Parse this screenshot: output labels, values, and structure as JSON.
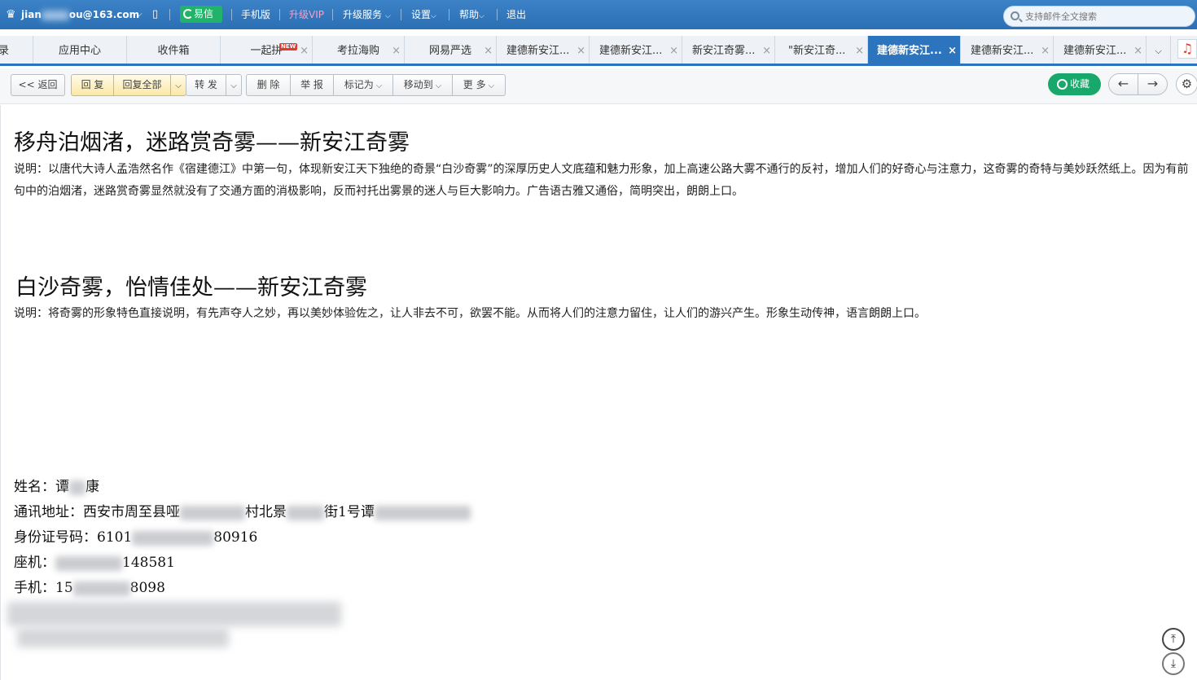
{
  "topbar": {
    "account": "jian",
    "account_tail": "ou@163.com",
    "yixin": "易信",
    "mobile": "手机版",
    "vip": "升级VIP",
    "upgrade": "升级服务",
    "settings": "设置",
    "help": "帮助",
    "logout": "退出",
    "search_placeholder": "支持邮件全文搜索"
  },
  "tabs": [
    {
      "label": "录"
    },
    {
      "label": "应用中心"
    },
    {
      "label": "收件箱"
    },
    {
      "label": "一起拼",
      "badge": "NEW"
    },
    {
      "label": "考拉海购"
    },
    {
      "label": "网易严选"
    },
    {
      "label": "建德新安江..."
    },
    {
      "label": "建德新安江..."
    },
    {
      "label": "新安江奇雾..."
    },
    {
      "label": "\"新安江奇..."
    },
    {
      "label": "建德新安江..."
    },
    {
      "label": "建德新安江..."
    },
    {
      "label": "建德新安江..."
    }
  ],
  "toolbar": {
    "back": "<< 返回",
    "reply": "回 复",
    "reply_all": "回复全部",
    "forward": "转 发",
    "delete": "删 除",
    "report": "举 报",
    "mark_as": "标记为",
    "move_to": "移动到",
    "more": "更 多",
    "favorite": "收藏"
  },
  "content": {
    "heading1": "移舟泊烟渚，迷路赏奇雾——新安江奇雾",
    "desc1": "说明：以唐代大诗人孟浩然名作《宿建德江》中第一句，体现新安江天下独绝的奇景“白沙奇雾”的深厚历史人文底蕴和魅力形象，加上高速公路大雾不通行的反衬，增加人们的好奇心与注意力，这奇雾的奇特与美妙跃然纸上。因为有前句中的泊烟渚，迷路赏奇雾显然就没有了交通方面的消极影响，反而衬托出雾景的迷人与巨大影响力。广告语古雅又通俗，简明突出，朗朗上口。",
    "heading2": "白沙奇雾，怡情佳处——新安江奇雾",
    "desc2": "说明：将奇雾的形象特色直接说明，有先声夺人之妙，再以美妙体验佐之，让人非去不可，欲罢不能。从而将人们的注意力留住，让人们的游兴产生。形象生动传神，语言朗朗上口。",
    "name_label": "姓名：",
    "name_a": "谭",
    "name_b": "康",
    "addr_label": "通讯地址：",
    "addr_a": "西安市周至县哑",
    "addr_b": "村北景",
    "addr_c": "街1号谭",
    "id_label": "身份证号码：",
    "id_a": "6101",
    "id_b": "80916",
    "phone_label": "座机：",
    "phone_b": "148581",
    "mobile_label": "手机：",
    "mobile_a": "15",
    "mobile_b": "8098"
  }
}
